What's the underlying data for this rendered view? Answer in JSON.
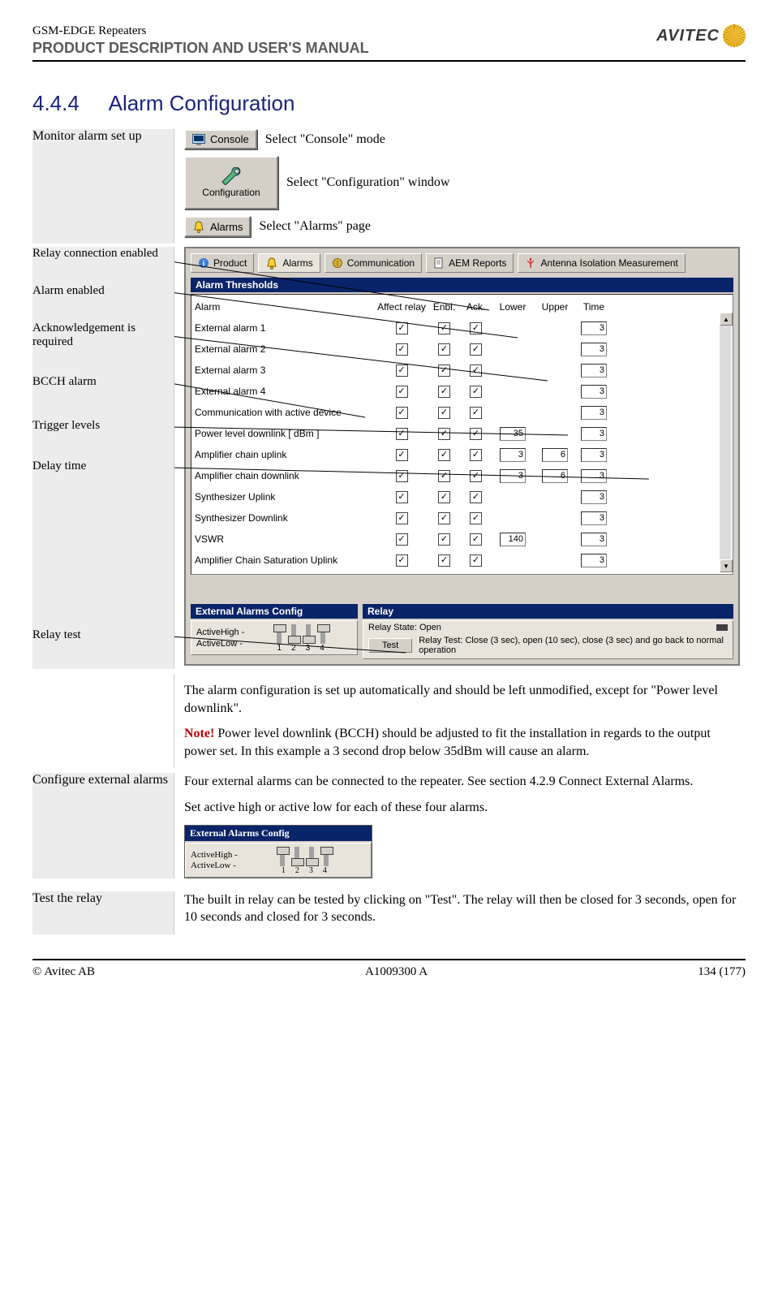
{
  "header": {
    "doc_family": "GSM-EDGE Repeaters",
    "doc_type": "PRODUCT DESCRIPTION AND USER'S MANUAL",
    "brand": "AVITEC"
  },
  "section": {
    "number": "4.4.4",
    "title": "Alarm Configuration"
  },
  "intro": {
    "left_label": "Monitor alarm set up",
    "console_label": "Console",
    "console_caption": "Select \"Console\" mode",
    "config_label": "Configuration",
    "config_caption": "Select \"Configuration\" window",
    "alarms_label": "Alarms",
    "alarms_caption": "Select \"Alarms\" page"
  },
  "diagram_labels": {
    "relay_conn": "Relay connection enabled",
    "alarm_enabled": "Alarm enabled",
    "ack_required": "Acknowledgement is required",
    "bcch": "BCCH alarm",
    "trigger": "Trigger levels",
    "delay": "Delay time",
    "relay_test": "Relay test"
  },
  "screenshot": {
    "tabs": {
      "product": "Product",
      "alarms": "Alarms",
      "communication": "Communication",
      "aem": "AEM Reports",
      "antenna": "Antenna Isolation Measurement"
    },
    "thresholds_title": "Alarm Thresholds",
    "columns": {
      "alarm": "Alarm",
      "affect_relay": "Affect relay",
      "enbl": "Enbl.",
      "ack": "Ack.",
      "lower": "Lower",
      "upper": "Upper",
      "time": "Time"
    },
    "rows": [
      {
        "name": "External alarm 1",
        "relay": true,
        "enbl": true,
        "ack": true,
        "lower": "",
        "upper": "",
        "time": "3"
      },
      {
        "name": "External alarm 2",
        "relay": true,
        "enbl": true,
        "ack": true,
        "lower": "",
        "upper": "",
        "time": "3"
      },
      {
        "name": "External alarm 3",
        "relay": true,
        "enbl": true,
        "ack": true,
        "lower": "",
        "upper": "",
        "time": "3"
      },
      {
        "name": "External alarm 4",
        "relay": true,
        "enbl": true,
        "ack": true,
        "lower": "",
        "upper": "",
        "time": "3"
      },
      {
        "name": "Communication with active device",
        "relay": true,
        "enbl": true,
        "ack": true,
        "lower": "",
        "upper": "",
        "time": "3"
      },
      {
        "name": "Power level downlink  [ dBm ]",
        "relay": true,
        "enbl": true,
        "ack": true,
        "lower": "35",
        "upper": "",
        "time": "3"
      },
      {
        "name": "Amplifier chain uplink",
        "relay": true,
        "enbl": true,
        "ack": true,
        "lower": "3",
        "upper": "6",
        "time": "3"
      },
      {
        "name": "Amplifier chain downlink",
        "relay": true,
        "enbl": true,
        "ack": true,
        "lower": "3",
        "upper": "6",
        "time": "3"
      },
      {
        "name": "Synthesizer Uplink",
        "relay": true,
        "enbl": true,
        "ack": true,
        "lower": "",
        "upper": "",
        "time": "3"
      },
      {
        "name": "Synthesizer Downlink",
        "relay": true,
        "enbl": true,
        "ack": true,
        "lower": "",
        "upper": "",
        "time": "3"
      },
      {
        "name": "VSWR",
        "relay": true,
        "enbl": true,
        "ack": true,
        "lower": "140",
        "upper": "",
        "time": "3"
      },
      {
        "name": "Amplifier Chain Saturation Uplink",
        "relay": true,
        "enbl": true,
        "ack": true,
        "lower": "",
        "upper": "",
        "time": "3"
      }
    ],
    "ext_config": {
      "title": "External Alarms Config",
      "row_high": "ActiveHigh",
      "row_low": "ActiveLow",
      "nums": [
        "1",
        "2",
        "3",
        "4"
      ],
      "positions": [
        "high",
        "low",
        "low",
        "high"
      ]
    },
    "relay": {
      "title": "Relay",
      "state_label": "Relay State: Open",
      "test_btn": "Test",
      "test_caption": "Relay Test: Close (3 sec), open (10 sec), close (3 sec) and go back to normal operation"
    }
  },
  "post_text": {
    "p1": "The alarm configuration is set up automatically and should be left unmodified, except for \"Power level downlink\".",
    "note_label": "Note!",
    "note_body": " Power level downlink (BCCH) should be adjusted to fit the installation in regards to the output power set. In this example a 3 second drop below 35dBm will cause an alarm."
  },
  "configure_ext": {
    "left_label": "Configure external alarms",
    "p1": "Four external alarms can be connected to the repeater. See section 4.2.9 Connect External Alarms.",
    "p2": "Set active high or active low for each of these four alarms."
  },
  "test_relay": {
    "left_label": "Test the relay",
    "p1": "The built in relay can be tested by clicking on \"Test\". The relay will then be closed for 3 seconds, open for 10 seconds and closed for 3 seconds."
  },
  "footer": {
    "left": "© Avitec AB",
    "center": "A1009300 A",
    "right": "134 (177)"
  }
}
